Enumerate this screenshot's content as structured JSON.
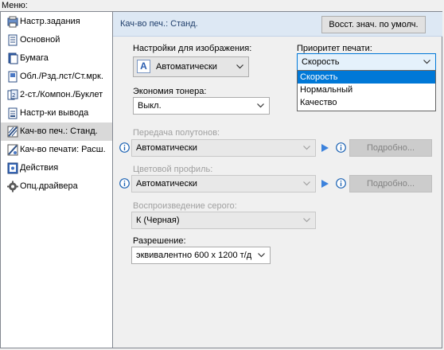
{
  "menu_label": "Меню:",
  "sidebar": {
    "items": [
      {
        "label": "Настр.задания",
        "icon": "job-settings-icon"
      },
      {
        "label": "Основной",
        "icon": "basic-icon"
      },
      {
        "label": "Бумага",
        "icon": "paper-icon"
      },
      {
        "label": "Обл./Рзд.лст/Ст.мрк.",
        "icon": "layout-icon"
      },
      {
        "label": "2-ст./Компон./Буклет",
        "icon": "duplex-icon"
      },
      {
        "label": "Настр-ки вывода",
        "icon": "output-icon"
      },
      {
        "label": "Кач-во печ.: Станд.",
        "icon": "print-quality-icon",
        "selected": true
      },
      {
        "label": "Кач-во печати: Расш.",
        "icon": "print-quality-advanced-icon"
      },
      {
        "label": "Действия",
        "icon": "actions-icon"
      },
      {
        "label": "Опц.драйвера",
        "icon": "driver-options-icon"
      }
    ]
  },
  "header": {
    "title": "Кач-во печ.: Станд.",
    "restore_button": "Восст. знач. по умолч."
  },
  "image_settings": {
    "label": "Настройки для изображения:",
    "value": "Автоматически",
    "icon_letter": "A"
  },
  "print_priority": {
    "label": "Приоритет печати:",
    "value": "Скорость",
    "options": [
      "Скорость",
      "Нормальный",
      "Качество"
    ],
    "highlighted_index": 0
  },
  "toner_save": {
    "label": "Экономия тонера:",
    "value": "Выкл."
  },
  "halftone": {
    "label": "Передача полутонов:",
    "value": "Автоматически",
    "details_button": "Подробно..."
  },
  "color_profile": {
    "label": "Цветовой профиль:",
    "value": "Автоматически",
    "details_button": "Подробно..."
  },
  "gray_reproduction": {
    "label": "Воспроизведение серого:",
    "value": "К (Черная)"
  },
  "resolution": {
    "label": "Разрешение:",
    "value": "эквивалентно 600 x 1200 т/д"
  },
  "colors": {
    "accent": "#0078d7",
    "header_bg": "#dde8f4",
    "info_icon": "#1e64b4",
    "play_icon": "#3c82dc"
  }
}
